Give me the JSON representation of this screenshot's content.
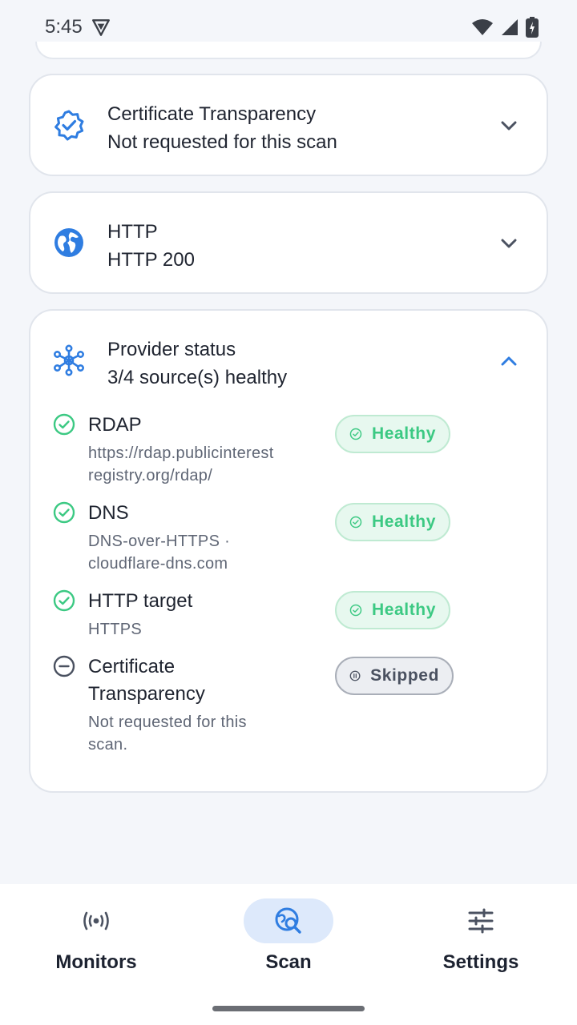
{
  "status_bar": {
    "time": "5:45"
  },
  "cards": {
    "ct": {
      "title": "Certificate Transparency",
      "subtitle": "Not requested for this scan"
    },
    "http": {
      "title": "HTTP",
      "subtitle": "HTTP 200"
    },
    "provider": {
      "title": "Provider status",
      "subtitle": "3/4 source(s) healthy"
    }
  },
  "providers": [
    {
      "name": "RDAP",
      "detail": "https://rdap.publicinterest registry.org/rdap/",
      "status": "Healthy"
    },
    {
      "name": "DNS",
      "detail": "DNS-over-HTTPS · cloudflare-dns.com",
      "status": "Healthy"
    },
    {
      "name": "HTTP target",
      "detail": "HTTPS",
      "status": "Healthy"
    },
    {
      "name": "Certificate Transparency",
      "detail": "Not requested for this scan.",
      "status": "Skipped"
    }
  ],
  "nav": {
    "monitors": "Monitors",
    "scan": "Scan",
    "settings": "Settings"
  },
  "colors": {
    "accent": "#2f7de1",
    "healthy": "#3cc983",
    "skipped": "#4a5160"
  },
  "icons": {
    "ct": "verified-badge-icon",
    "http": "globe-icon",
    "provider": "hub-icon",
    "monitors": "broadcast-icon",
    "scan": "scan-search-icon",
    "settings": "sliders-icon"
  }
}
